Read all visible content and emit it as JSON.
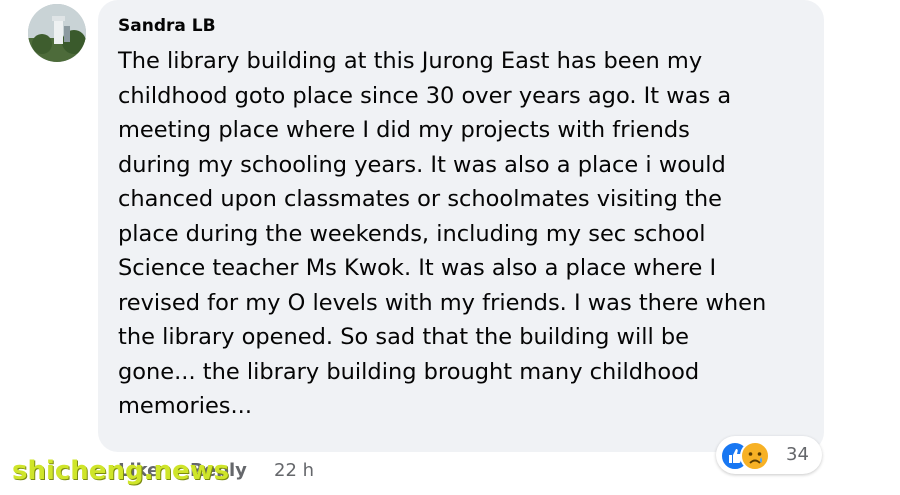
{
  "comment": {
    "author": "Sandra LB",
    "text_lines": [
      "The library building at this Jurong East has been my",
      "childhood goto place since 30 over years ago. It was a",
      "meeting place where I did my projects with friends",
      "during my schooling years. It was also a place i would",
      "chanced upon classmates or schoolmates visiting the",
      "place during the weekends, including my sec school",
      "Science teacher Ms Kwok. It was also a place where I",
      "revised for my O levels with my friends. I was there when",
      "the library opened. So sad that the building will be",
      "gone... the library building brought many childhood",
      "memories..."
    ],
    "reactions": {
      "icons": [
        "like-icon",
        "sad-icon"
      ],
      "count": "34",
      "like_color": "#1877f2",
      "sad_color": "#f7b125"
    },
    "actions": {
      "like_label": "Like",
      "reply_label": "Reply",
      "timestamp": "22 h"
    }
  },
  "watermark": "shicheng.news"
}
